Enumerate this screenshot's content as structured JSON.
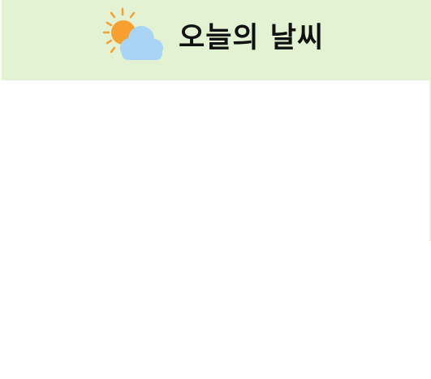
{
  "header": {
    "title": "오늘의 날씨",
    "icon": "sun-behind-cloud-icon"
  },
  "colors": {
    "header_background": "#e3f2d3",
    "sun": "#f7a030",
    "sun_rays": "#f7a030",
    "cloud": "#a9d4f5",
    "title_text": "#111111"
  }
}
